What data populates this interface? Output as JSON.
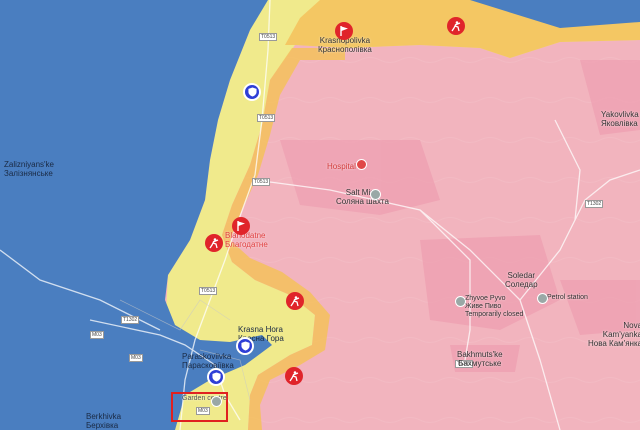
{
  "places": {
    "zaliznyanske": "Zalizniyans'ke\nЗалізнянське",
    "krasnopolivka": "Krasnopolivka\nКраснополівка",
    "yakovlivka": "Yakovlivka\nЯковлівка",
    "salt_mine": "Salt Mine\nСоляна шахта",
    "hospital": "Hospital",
    "blahodatne": "Blahodatne\nБлагодатне",
    "soledar": "Soledar\nСоледар",
    "zhyvoe_pyvo": "Zhyvoe Pyvo\nЖиве Пиво\nTemporarily closed",
    "petrol_station": "Petrol station",
    "krasna_hora": "Krasna Hora\nКрасна Гора",
    "paraskoviivka": "Paraskoviivka\nПарасковіївка",
    "nova_kamianka": "Nova\nKam'yanka\nНова Кам'янка",
    "bakhmutske": "Bakhmuts'ke\nБахмутське",
    "berkhivka": "Berkhivka\nБерхівка",
    "garden_centre": "Garden centre"
  },
  "roads": {
    "t0513_a": "T0513",
    "t0513_b": "T0513",
    "t0513_c": "T0513",
    "t0513_d": "T0513",
    "t1302_a": "T1302",
    "t1302_b": "T1302",
    "t1302_c": "T1302",
    "m03_a": "M03",
    "m03_b": "M03",
    "m03_c": "M03"
  },
  "colors": {
    "ukraine_held": "#4a7ec0",
    "russia_held": "#f2b4be",
    "contested": "#f4c15c",
    "advance": "#f0ea8c",
    "russian_marker": "#e0242a",
    "ukrainian_marker": "#2f3fd6",
    "highlight_box": "#e02020"
  },
  "markers": [
    {
      "type": "flag",
      "side": "russia",
      "icon": "flag-icon"
    },
    {
      "type": "assault",
      "side": "russia",
      "icon": "assault-icon"
    },
    {
      "type": "shield",
      "side": "ukraine",
      "icon": "shield-icon"
    }
  ]
}
